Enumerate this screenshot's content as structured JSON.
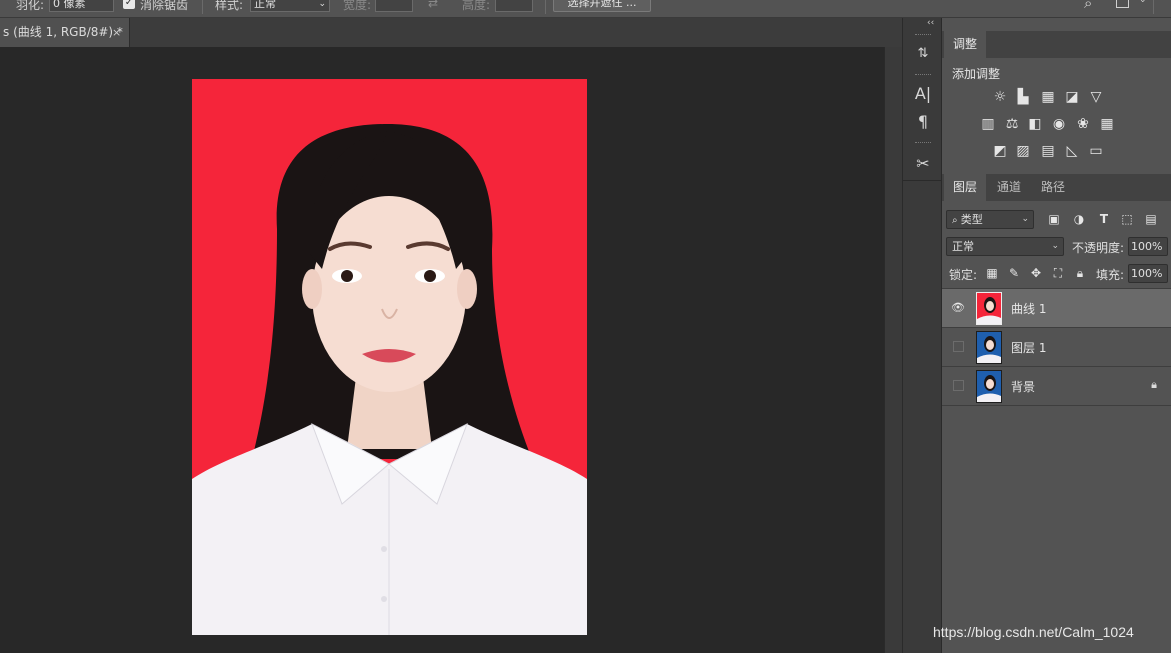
{
  "options_bar": {
    "feather_label": "羽化:",
    "feather_value": "0 像素",
    "antialias_label": "消除锯齿",
    "style_label": "样式:",
    "style_value": "正常",
    "width_label": "宽度:",
    "height_label": "高度:",
    "swap_icon": "swap-arrow-icon",
    "select_mask_button": "选择并遮住 ..."
  },
  "document_tab": {
    "title": "s (曲线 1, RGB/8#) *",
    "close": "×"
  },
  "adjustments_panel": {
    "tab_label": "调整",
    "add_adjustment_label": "添加调整",
    "icons_row1": [
      "brightness-contrast-icon",
      "levels-icon",
      "curves-icon",
      "exposure-icon",
      "vibrance-icon"
    ],
    "icons_row2": [
      "hue-saturation-icon",
      "color-balance-icon",
      "black-white-icon",
      "photo-filter-icon",
      "channel-mixer-icon",
      "color-lookup-icon"
    ],
    "icons_row3": [
      "invert-icon",
      "posterize-icon",
      "threshold-icon",
      "selective-color-icon",
      "gradient-map-icon"
    ]
  },
  "layers_panel": {
    "tabs": [
      "图层",
      "通道",
      "路径"
    ],
    "filter_kind": "类型",
    "blend_mode": "正常",
    "opacity_label": "不透明度:",
    "opacity_value": "100%",
    "lock_label": "锁定:",
    "fill_label": "填充:",
    "fill_value": "100%",
    "layers": [
      {
        "name": "曲线 1",
        "visible": true,
        "selected": true,
        "thumb_bg": "#f5253a"
      },
      {
        "name": "图层 1",
        "visible": false,
        "selected": false,
        "thumb_bg": "#1f5fae"
      },
      {
        "name": "背景",
        "visible": false,
        "selected": false,
        "locked": true,
        "thumb_bg": "#1f5fae"
      }
    ]
  },
  "canvas": {
    "background_color": "#f5253a"
  },
  "watermark": "https://blog.csdn.net/Calm_1024"
}
